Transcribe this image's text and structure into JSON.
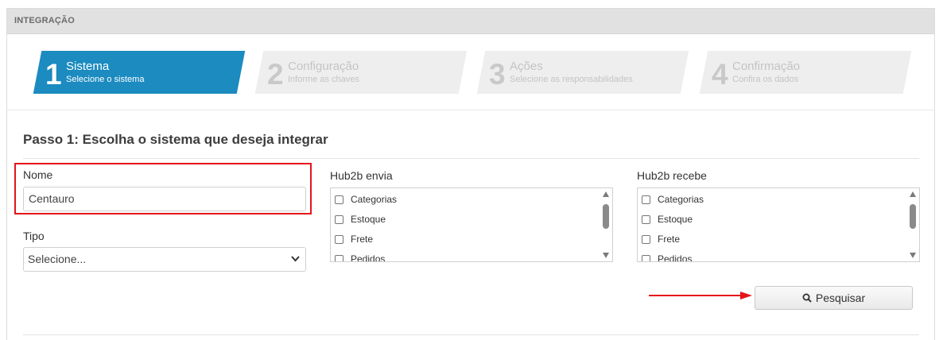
{
  "header": {
    "title": "INTEGRAÇÃO"
  },
  "steps": [
    {
      "number": "1",
      "title": "Sistema",
      "subtitle": "Selecione o sistema",
      "active": true
    },
    {
      "number": "2",
      "title": "Configuração",
      "subtitle": "Informe as chaves",
      "active": false
    },
    {
      "number": "3",
      "title": "Ações",
      "subtitle": "Selecione as responsabilidades",
      "active": false
    },
    {
      "number": "4",
      "title": "Confirmação",
      "subtitle": "Confira os dados",
      "active": false
    }
  ],
  "form": {
    "heading": "Passo 1: Escolha o sistema que deseja integrar",
    "nome": {
      "label": "Nome",
      "value": "Centauro"
    },
    "tipo": {
      "label": "Tipo",
      "selected": "Selecione..."
    },
    "hub2b_envia": {
      "label": "Hub2b envia",
      "items": [
        "Categorias",
        "Estoque",
        "Frete",
        "Pedidos"
      ]
    },
    "hub2b_recebe": {
      "label": "Hub2b recebe",
      "items": [
        "Categorias",
        "Estoque",
        "Frete",
        "Pedidos"
      ]
    },
    "search_button": "Pesquisar"
  },
  "colors": {
    "active_step": "#1b8bc0",
    "highlight": "#e5141a"
  }
}
